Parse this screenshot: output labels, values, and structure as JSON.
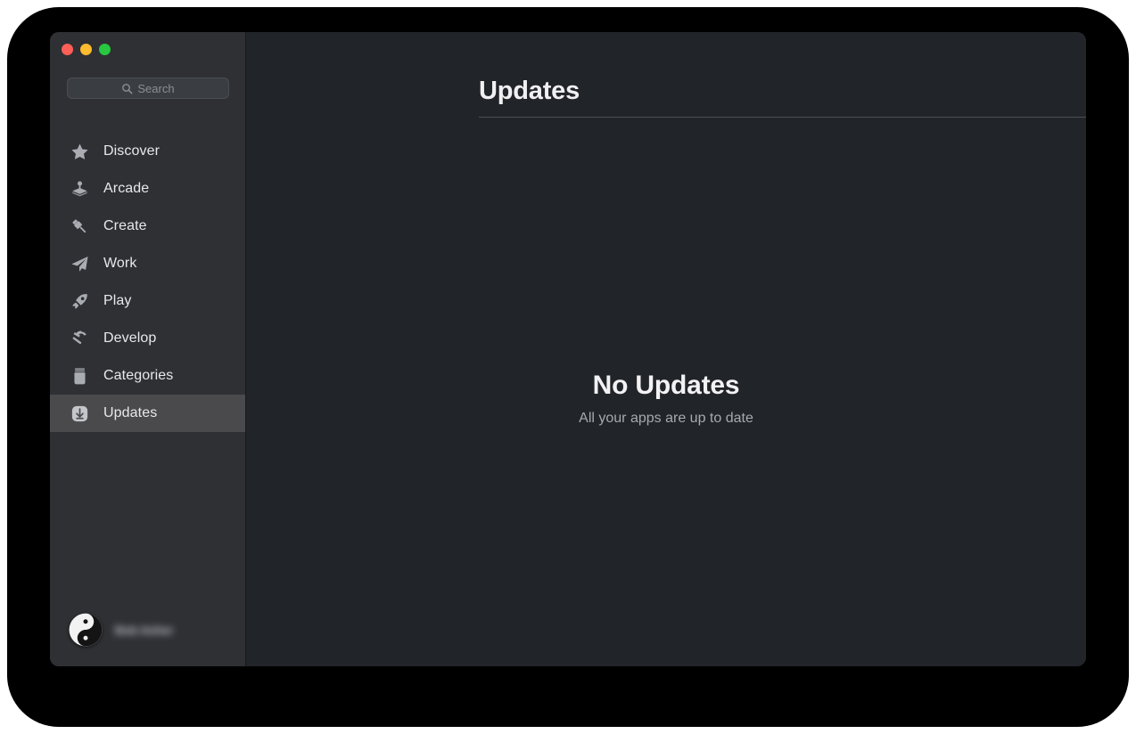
{
  "window": {
    "traffic_lights": [
      {
        "name": "close",
        "color": "#ff5f57"
      },
      {
        "name": "minimize",
        "color": "#febc2e"
      },
      {
        "name": "zoom",
        "color": "#28c840"
      }
    ]
  },
  "sidebar": {
    "search": {
      "placeholder": "Search",
      "value": "",
      "icon": "search-icon"
    },
    "items": [
      {
        "label": "Discover",
        "icon": "star-icon",
        "selected": false
      },
      {
        "label": "Arcade",
        "icon": "joystick-icon",
        "selected": false
      },
      {
        "label": "Create",
        "icon": "paintbrush-icon",
        "selected": false
      },
      {
        "label": "Work",
        "icon": "paper-plane-icon",
        "selected": false
      },
      {
        "label": "Play",
        "icon": "rocket-icon",
        "selected": false
      },
      {
        "label": "Develop",
        "icon": "hammer-icon",
        "selected": false
      },
      {
        "label": "Categories",
        "icon": "jar-icon",
        "selected": false
      },
      {
        "label": "Updates",
        "icon": "download-icon",
        "selected": true
      }
    ],
    "account": {
      "name": "Bob Asher",
      "avatar_icon": "yin-yang-avatar",
      "name_redacted": true
    },
    "selected_color": "#4a4a4d",
    "background_color": "#2e3034"
  },
  "main": {
    "title": "Updates",
    "empty_state": {
      "title": "No Updates",
      "subtitle": "All your apps are up to date"
    },
    "background_color": "#212428"
  }
}
